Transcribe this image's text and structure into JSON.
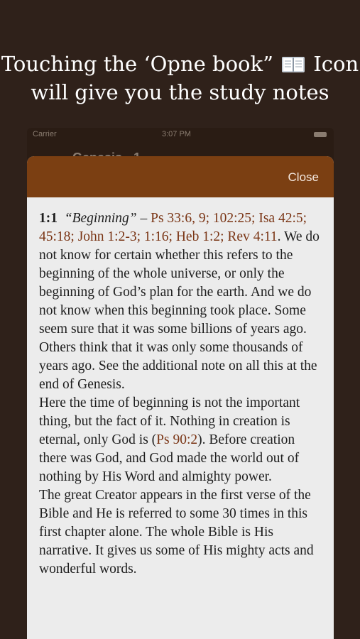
{
  "caption": {
    "line1_before": "Touching the ‘Opne book”",
    "line1_after": "Icon",
    "line2": "will give you the study notes",
    "icon": "open-book-icon"
  },
  "status_bar": {
    "carrier": "Carrier",
    "time": "3:07 PM"
  },
  "nav": {
    "title": "Genesis - 1 -"
  },
  "sheet": {
    "close_label": "Close",
    "header_color": "#7b3f12",
    "link_color": "#7a3515"
  },
  "note": {
    "verse": "1:1",
    "term": "“Beginning”",
    "dash": " – ",
    "refs": [
      "Ps 33:6, 9; 102:25;",
      "Isa 42:5; 45:18; John 1:2-3; 1:16; Heb 1:2;",
      "Rev 4:11"
    ],
    "p1_rest": ". We do not know for certain whether this refers to the beginning of the whole universe, or only the beginning of God’s plan for the earth. And we do not know when this beginning took place. Some seem sure that it was some billions of years ago. Others think that it was only some thousands of years ago. See the additional note on all this at the end of Genesis.",
    "p2_before": "Here the time of beginning is not the important thing, but the fact of it. Nothing in creation is eternal, only God is (",
    "p2_ref": "Ps 90:2",
    "p2_after": "). Before creation there was God, and God made the world out of nothing by His Word and almighty power.",
    "p3": "The great Creator appears in the first verse of the Bible and He is referred to some 30 times in this first chapter alone. The whole Bible is His narrative. It gives us some of His mighty acts and wonderful words."
  }
}
